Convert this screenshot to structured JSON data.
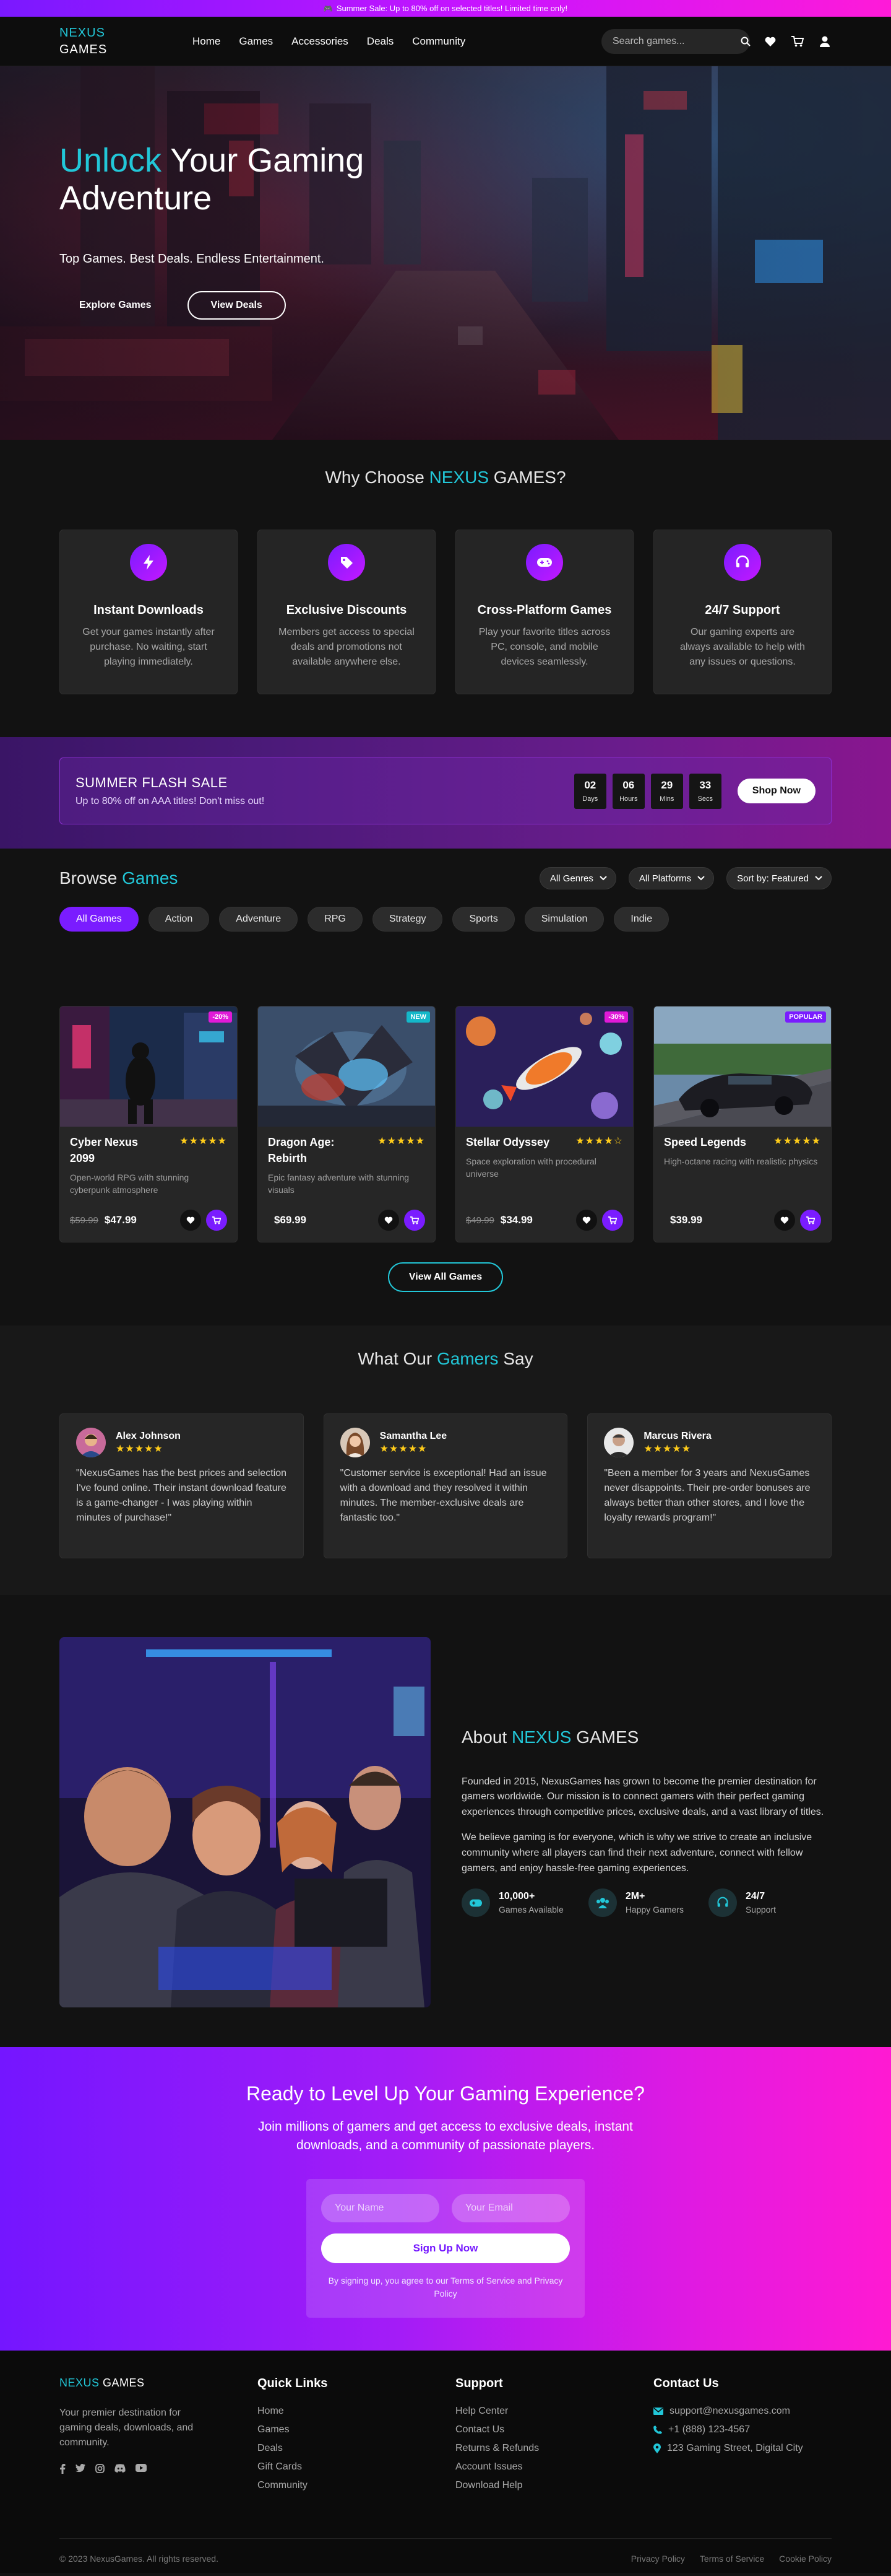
{
  "promo": {
    "icon": "gamepad-icon",
    "text": "Summer Sale: Up to 80% off on selected titles! Limited time only!"
  },
  "header": {
    "logo_top": "NEXUS",
    "logo_bottom": "GAMES",
    "nav": [
      "Home",
      "Games",
      "Accessories",
      "Deals",
      "Community"
    ],
    "search_placeholder": "Search games...",
    "icons": [
      "search-icon",
      "heart-icon",
      "cart-icon",
      "user-icon"
    ]
  },
  "hero": {
    "title_accent": "Unlock",
    "title_rest": " Your Gaming",
    "title_line2": "Adventure",
    "tagline": "Top Games. Best Deals. Endless Entertainment.",
    "btn_explore": "Explore Games",
    "btn_deals": "View Deals"
  },
  "why": {
    "title_pre": "Why Choose ",
    "title_brand": "NEXUS",
    "title_post": " GAMES?",
    "features": [
      {
        "icon": "bolt-icon",
        "title": "Instant Downloads",
        "text": "Get your games instantly after purchase. No waiting, start playing immediately."
      },
      {
        "icon": "tag-icon",
        "title": "Exclusive Discounts",
        "text": "Members get access to special deals and promotions not available anywhere else."
      },
      {
        "icon": "gamepad-icon",
        "title": "Cross-Platform Games",
        "text": "Play your favorite titles across PC, console, and mobile devices seamlessly."
      },
      {
        "icon": "headset-icon",
        "title": "24/7 Support",
        "text": "Our gaming experts are always available to help with any issues or questions."
      }
    ]
  },
  "flash": {
    "title": "SUMMER FLASH SALE",
    "subtitle": "Up to 80% off on AAA titles! Don't miss out!",
    "countdown": [
      {
        "value": "02",
        "unit": "Days"
      },
      {
        "value": "06",
        "unit": "Hours"
      },
      {
        "value": "29",
        "unit": "Mins"
      },
      {
        "value": "33",
        "unit": "Secs"
      }
    ],
    "btn": "Shop Now"
  },
  "browse": {
    "title_pre": "Browse ",
    "title_accent": "Games",
    "filters": [
      "All Genres",
      "All Platforms",
      "Sort by: Featured"
    ],
    "categories": [
      "All Games",
      "Action",
      "Adventure",
      "RPG",
      "Strategy",
      "Sports",
      "Simulation",
      "Indie"
    ],
    "active_category": "All Games",
    "games": [
      {
        "title": "Cyber Nexus 2099",
        "rating": 4.5,
        "stars": "★★★★★",
        "desc": "Open-world RPG with stunning cyberpunk atmosphere",
        "old_price": "$59.99",
        "price": "$47.99",
        "badge": "-20%",
        "badge_color": "#e01ad8"
      },
      {
        "title": "Dragon Age: Rebirth",
        "rating": 5,
        "stars": "★★★★★",
        "desc": "Epic fantasy adventure with stunning visuals",
        "old_price": "",
        "price": "$69.99",
        "badge": "NEW",
        "badge_color": "#14b8c9"
      },
      {
        "title": "Stellar Odyssey",
        "rating": 4,
        "stars": "★★★★☆",
        "desc": "Space exploration with procedural universe",
        "old_price": "$49.99",
        "price": "$34.99",
        "badge": "-30%",
        "badge_color": "#e01ad8"
      },
      {
        "title": "Speed Legends",
        "rating": 4.5,
        "stars": "★★★★★",
        "desc": "High-octane racing with realistic physics",
        "old_price": "",
        "price": "$39.99",
        "badge": "POPULAR",
        "badge_color": "#7a1cff"
      }
    ],
    "view_all": "View All Games"
  },
  "testimonials": {
    "title_pre": "What Our ",
    "title_accent": "Gamers",
    "title_post": " Say",
    "items": [
      {
        "name": "Alex Johnson",
        "rating": 5,
        "stars": "★★★★★",
        "quote": "\"NexusGames has the best prices and selection I've found online. Their instant download feature is a game-changer - I was playing within minutes of purchase!\""
      },
      {
        "name": "Samantha Lee",
        "rating": 4.5,
        "stars": "★★★★★",
        "quote": "\"Customer service is exceptional! Had an issue with a download and they resolved it within minutes. The member-exclusive deals are fantastic too.\""
      },
      {
        "name": "Marcus Rivera",
        "rating": 5,
        "stars": "★★★★★",
        "quote": "\"Been a member for 3 years and NexusGames never disappoints. Their pre-order bonuses are always better than other stores, and I love the loyalty rewards program!\""
      }
    ]
  },
  "about": {
    "title_pre": "About ",
    "title_brand": "NEXUS",
    "title_post": " GAMES",
    "p1": "Founded in 2015, NexusGames has grown to become the premier destination for gamers worldwide. Our mission is to connect gamers with their perfect gaming experiences through competitive prices, exclusive deals, and a vast library of titles.",
    "p2": "We believe gaming is for everyone, which is why we strive to create an inclusive community where all players can find their next adventure, connect with fellow gamers, and enjoy hassle-free gaming experiences.",
    "stats": [
      {
        "icon": "gamepad-icon",
        "value": "10,000+",
        "label": "Games Available"
      },
      {
        "icon": "users-icon",
        "value": "2M+",
        "label": "Happy Gamers"
      },
      {
        "icon": "headset-icon",
        "value": "24/7",
        "label": "Support"
      }
    ]
  },
  "cta": {
    "title": "Ready to Level Up Your Gaming Experience?",
    "subtitle": "Join millions of gamers and get access to exclusive deals, instant downloads, and a community of passionate players.",
    "name_placeholder": "Your Name",
    "email_placeholder": "Your Email",
    "btn": "Sign Up Now",
    "note": "By signing up, you agree to our Terms of Service and Privacy Policy"
  },
  "footer": {
    "brand_accent": "NEXUS",
    "brand_rest": " GAMES",
    "desc": "Your premier destination for gaming deals, downloads, and community.",
    "socials": [
      "facebook-icon",
      "twitter-icon",
      "instagram-icon",
      "discord-icon",
      "youtube-icon"
    ],
    "quick_title": "Quick Links",
    "quick_links": [
      "Home",
      "Games",
      "Deals",
      "Gift Cards",
      "Community"
    ],
    "support_title": "Support",
    "support_links": [
      "Help Center",
      "Contact Us",
      "Returns & Refunds",
      "Account Issues",
      "Download Help"
    ],
    "contact_title": "Contact Us",
    "contact": [
      {
        "icon": "envelope-icon",
        "text": "support@nexusgames.com"
      },
      {
        "icon": "phone-icon",
        "text": "+1 (888) 123-4567"
      },
      {
        "icon": "location-pin-icon",
        "text": "123 Gaming Street, Digital City"
      }
    ],
    "copyright": "© 2023 NexusGames. All rights reserved.",
    "legal": [
      "Privacy Policy",
      "Terms of Service",
      "Cookie Policy"
    ]
  },
  "colors": {
    "accent": "#22c7d8",
    "brand_purple": "#7a1cff",
    "brand_pink": "#ff1ad2",
    "star": "#ffcc1a",
    "background": "#121212"
  }
}
